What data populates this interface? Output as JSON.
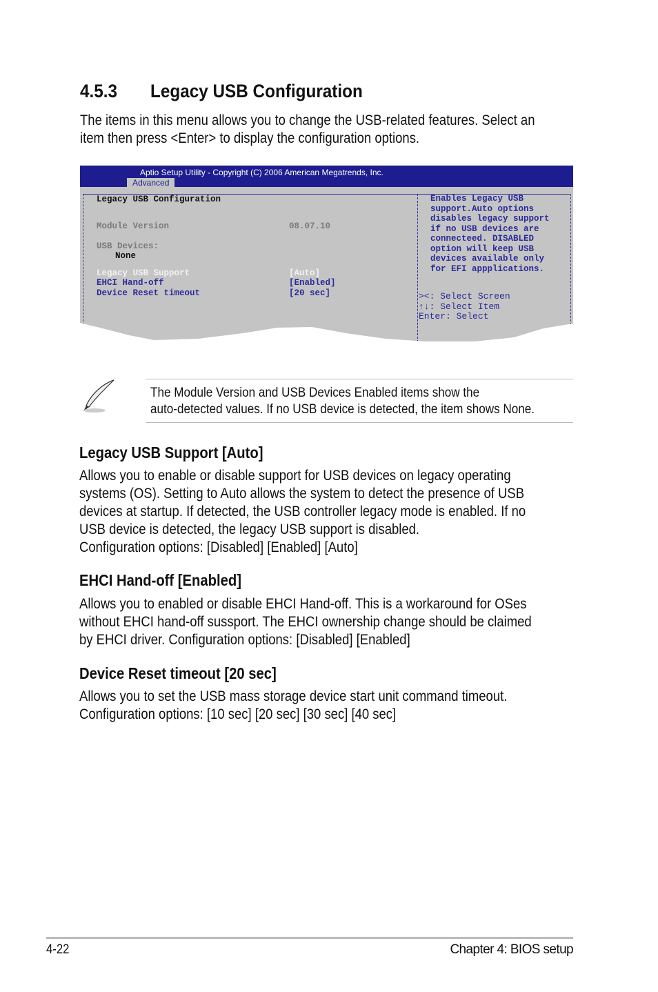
{
  "section": {
    "number": "4.5.3",
    "title": "Legacy USB Configuration"
  },
  "intro": [
    "The items in this menu allows you to change the USB-related features. Select an",
    "item then press <Enter> to display the configuration options."
  ],
  "bios": {
    "header": "Aptio Setup Utility - Copyright (C) 2006 American Megatrends, Inc.",
    "tab": "Advanced",
    "title": "Legacy USB Configuration",
    "module_version_label": "Module Version",
    "module_version_value": "08.07.10",
    "usb_devices_label": "USB Devices:",
    "usb_devices_value": "None",
    "items": [
      {
        "label": "Legacy USB Support",
        "value": "[Auto]"
      },
      {
        "label": "EHCI Hand-off",
        "value": "[Enabled]"
      },
      {
        "label": "Device Reset timeout",
        "value": "[20 sec]"
      }
    ],
    "help": [
      "Enables Legacy USB",
      "support.Auto options",
      "disables legacy support",
      "if no USB devices are",
      "connecteed. DISABLED",
      "option will keep USB",
      "devices available only",
      "for EFI appplications."
    ],
    "keys": [
      "><: Select Screen",
      "↑↓: Select Item",
      "Enter: Select"
    ],
    "colors": {
      "header_bg": "#1d1d8f",
      "body_bg": "#c4c4c4",
      "item_text": "#2b2b9a"
    }
  },
  "note": [
    "The Module Version and USB Devices Enabled items show the",
    "auto-detected values. If no USB device is detected, the item shows None."
  ],
  "sections": [
    {
      "title": "Legacy USB Support [Auto]",
      "lines": [
        "Allows you to enable or disable support for USB devices on legacy operating",
        "systems (OS). Setting to Auto allows the system to detect the presence of USB",
        "devices at startup. If detected, the USB controller legacy mode is enabled. If no",
        "USB device is detected, the legacy USB support is disabled.",
        "Configuration options: [Disabled] [Enabled] [Auto]"
      ]
    },
    {
      "title": "EHCI Hand-off [Enabled]",
      "lines": [
        "Allows you to enabled or disable EHCI Hand-off. This is a workaround for OSes",
        "without EHCI hand-off sussport. The EHCI ownership change should be claimed",
        "by EHCI driver. Configuration options: [Disabled] [Enabled]"
      ]
    },
    {
      "title": "Device Reset timeout [20 sec]",
      "lines": [
        "Allows you to set the USB mass storage device start unit command timeout.",
        "Configuration options: [10 sec] [20 sec] [30 sec] [40 sec]"
      ]
    }
  ],
  "footer": {
    "page": "4-22",
    "chapter": "Chapter 4: BIOS setup"
  }
}
